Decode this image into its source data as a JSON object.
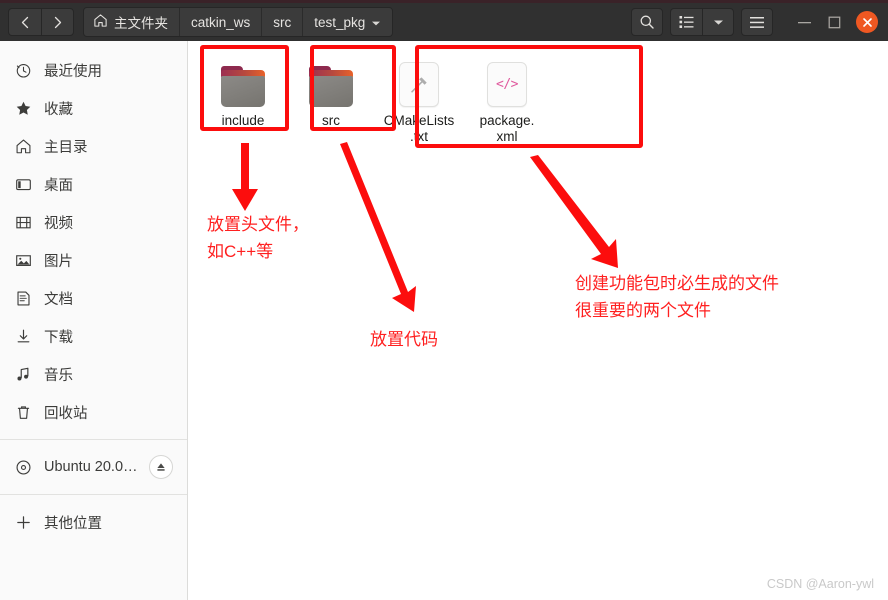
{
  "window": {
    "accent_color": "#3a2228",
    "header_bg": "#303030",
    "close_color": "#ef5822"
  },
  "header": {
    "nav": [
      {
        "name": "back",
        "label": "‹"
      },
      {
        "name": "forward",
        "label": "›"
      }
    ],
    "breadcrumbs": [
      {
        "label": "主文件夹",
        "icon": "home-icon"
      },
      {
        "label": "catkin_ws",
        "icon": ""
      },
      {
        "label": "src",
        "icon": ""
      },
      {
        "label": "test_pkg",
        "icon": "chevron-down-icon"
      }
    ],
    "tools": {
      "search": "search-icon",
      "view_list": "list-view-icon",
      "view_dropdown": "chevron-down-icon",
      "menu": "hamburger-menu-icon"
    },
    "window_controls": {
      "minimize": "–",
      "maximize": "□",
      "close": "✕"
    }
  },
  "sidebar": {
    "items": [
      {
        "label": "最近使用",
        "icon": "clock-icon"
      },
      {
        "label": "收藏",
        "icon": "star-icon"
      },
      {
        "label": "主目录",
        "icon": "home-icon"
      },
      {
        "label": "桌面",
        "icon": "desktop-icon"
      },
      {
        "label": "视频",
        "icon": "video-icon"
      },
      {
        "label": "图片",
        "icon": "image-icon"
      },
      {
        "label": "文档",
        "icon": "document-icon"
      },
      {
        "label": "下载",
        "icon": "download-icon"
      },
      {
        "label": "音乐",
        "icon": "music-icon"
      },
      {
        "label": "回收站",
        "icon": "trash-icon"
      }
    ],
    "device": {
      "label": "Ubuntu 20.0…",
      "icon": "disc-icon",
      "eject": "eject-icon"
    },
    "other": {
      "label": "其他位置",
      "icon": "plus-icon"
    }
  },
  "files": [
    {
      "name": "include",
      "type": "folder",
      "icon": "folder-icon"
    },
    {
      "name": "src",
      "type": "folder",
      "icon": "folder-icon"
    },
    {
      "name": "CMakeLists\n.txt",
      "type": "file",
      "icon": "hammer-icon"
    },
    {
      "name": "package.\nxml",
      "type": "file",
      "icon": "code-icon"
    }
  ],
  "annotations": {
    "color": "#ff2020",
    "box_color": "#fc0d0d",
    "notes": [
      {
        "text": "放置头文件，\n如C++等",
        "target": "include"
      },
      {
        "text": "放置代码",
        "target": "src"
      },
      {
        "text": "创建功能包时必生成的文件\n很重要的两个文件",
        "target": "cmake-package"
      }
    ]
  },
  "watermark": "CSDN @Aaron-ywl"
}
